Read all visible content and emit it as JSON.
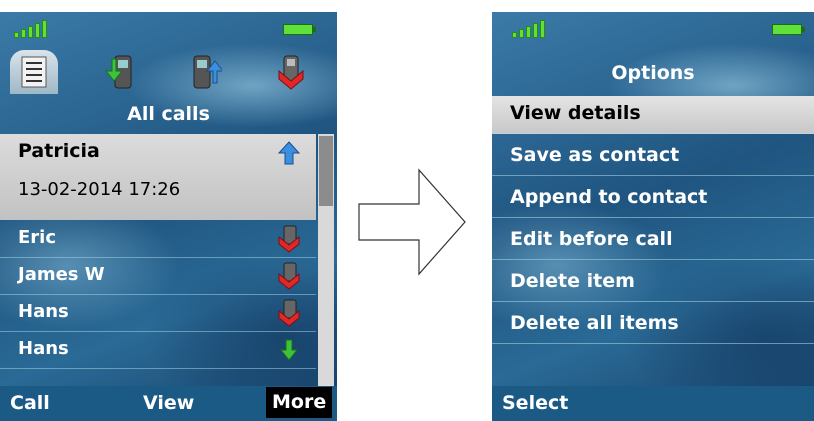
{
  "left_screen": {
    "tabs": [
      {
        "icon": "call-log-list-icon",
        "active": true
      },
      {
        "icon": "incoming-call-icon",
        "active": false
      },
      {
        "icon": "outgoing-call-icon",
        "active": false
      },
      {
        "icon": "missed-call-icon",
        "active": false
      }
    ],
    "title": "All calls",
    "selected_call": {
      "name": "Patricia",
      "datetime": "13-02-2014 17:26",
      "icon": "outgoing-arrow-icon"
    },
    "calls": [
      {
        "name": "Eric",
        "icon": "missed-call-icon"
      },
      {
        "name": "James W",
        "icon": "missed-call-icon"
      },
      {
        "name": "Hans",
        "icon": "missed-call-icon"
      },
      {
        "name": "Hans",
        "icon": "incoming-arrow-icon"
      }
    ],
    "softkeys": {
      "left": "Call",
      "middle": "View",
      "right": "More"
    }
  },
  "right_screen": {
    "title": "Options",
    "options": [
      "View details",
      "Save as contact",
      "Append to contact",
      "Edit before call",
      "Delete item",
      "Delete all items"
    ],
    "selected_index": 0,
    "softkeys": {
      "left": "Select"
    }
  },
  "colors": {
    "accent_blue": "#1c5a86",
    "battery_green": "#5fe03a",
    "selection_gray": "#d0d0d0"
  }
}
